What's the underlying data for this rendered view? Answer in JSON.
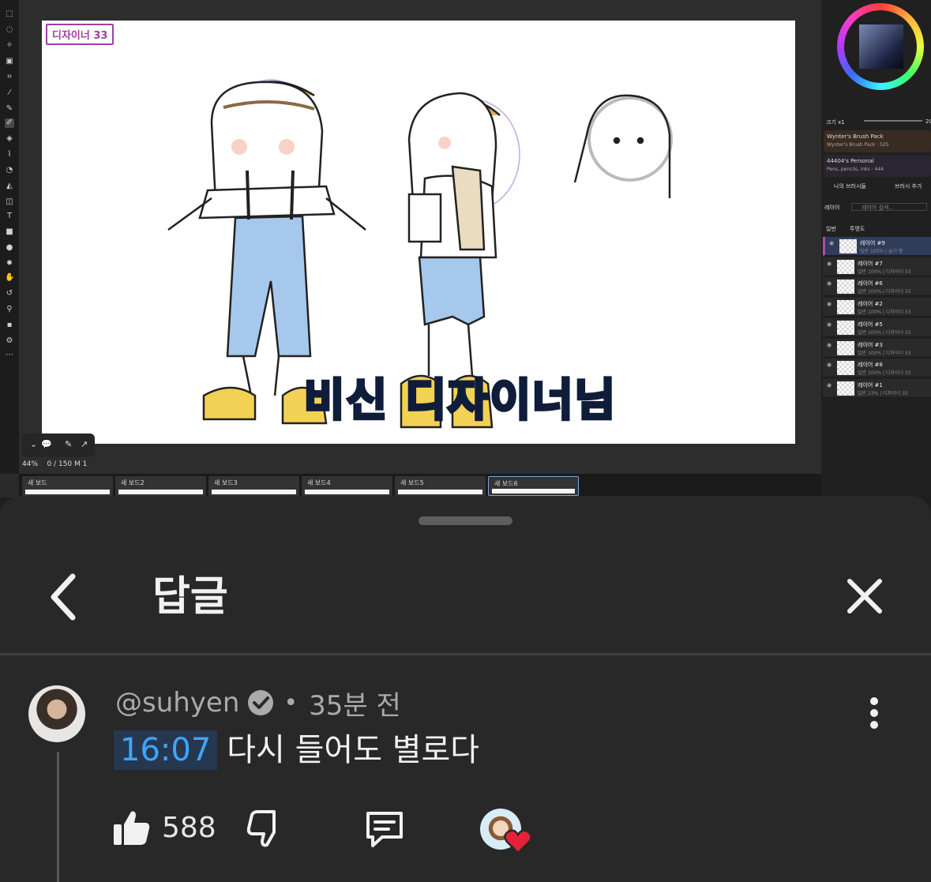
{
  "video": {
    "board_label": "디자이너 33",
    "overlay_title": "비신 디자이너님",
    "status": {
      "zoom": "44%",
      "frames": "0 / 150",
      "frame_suffix": "M 1"
    },
    "boards": [
      "새 보드",
      "새 보드2",
      "새 보드3",
      "새 보드4",
      "새 보드5",
      "새 보드6"
    ],
    "right_panel": {
      "size_label": "크기 x1",
      "size_value": "20",
      "packs": [
        {
          "name": "Wynter's Brush Pack",
          "sub": "Wynter's Brush Pack · 525"
        },
        {
          "name": "44404's Personal",
          "sub": "Pens, pencils, inks · 444"
        }
      ],
      "my_brushes": "나의 브러시들",
      "add_brush": "브러시 추가",
      "layers_label": "레이어",
      "layer_search_placeholder": "레이어 검색...",
      "blend_mode": "일반",
      "opacity_label": "투명도",
      "layers": [
        {
          "name": "레이어 #9",
          "meta": "일반 100% | 슬기 짱"
        },
        {
          "name": "레이어 #7",
          "meta": "일반 100% | 디자이너 33"
        },
        {
          "name": "레이어 #6",
          "meta": "일반 100% | 디자이너 33"
        },
        {
          "name": "레이어 #2",
          "meta": "일반 100% | 디자이너 33"
        },
        {
          "name": "레이어 #5",
          "meta": "일반 100% | 디자이너 33"
        },
        {
          "name": "레이어 #3",
          "meta": "일반 100% | 디자이너 33"
        },
        {
          "name": "레이어 #8",
          "meta": "일반 100% | 디자이너 33"
        },
        {
          "name": "레이어 #1",
          "meta": "일반 23% | 디자이너 33"
        }
      ]
    }
  },
  "sheet": {
    "title": "답글",
    "icons": {
      "back": "chevron-left-icon",
      "close": "close-icon",
      "more": "more-vertical-icon"
    }
  },
  "comment": {
    "author": "@suhyen",
    "separator": "•",
    "time": "35분 전",
    "timestamp_link": "16:07",
    "text": "다시 들어도 별로다",
    "like_count": "588"
  },
  "colors": {
    "sheet_bg": "#282828",
    "timestamp_bg": "#263850",
    "timestamp_text": "#3ea6ff",
    "heart": "#e5223a"
  }
}
